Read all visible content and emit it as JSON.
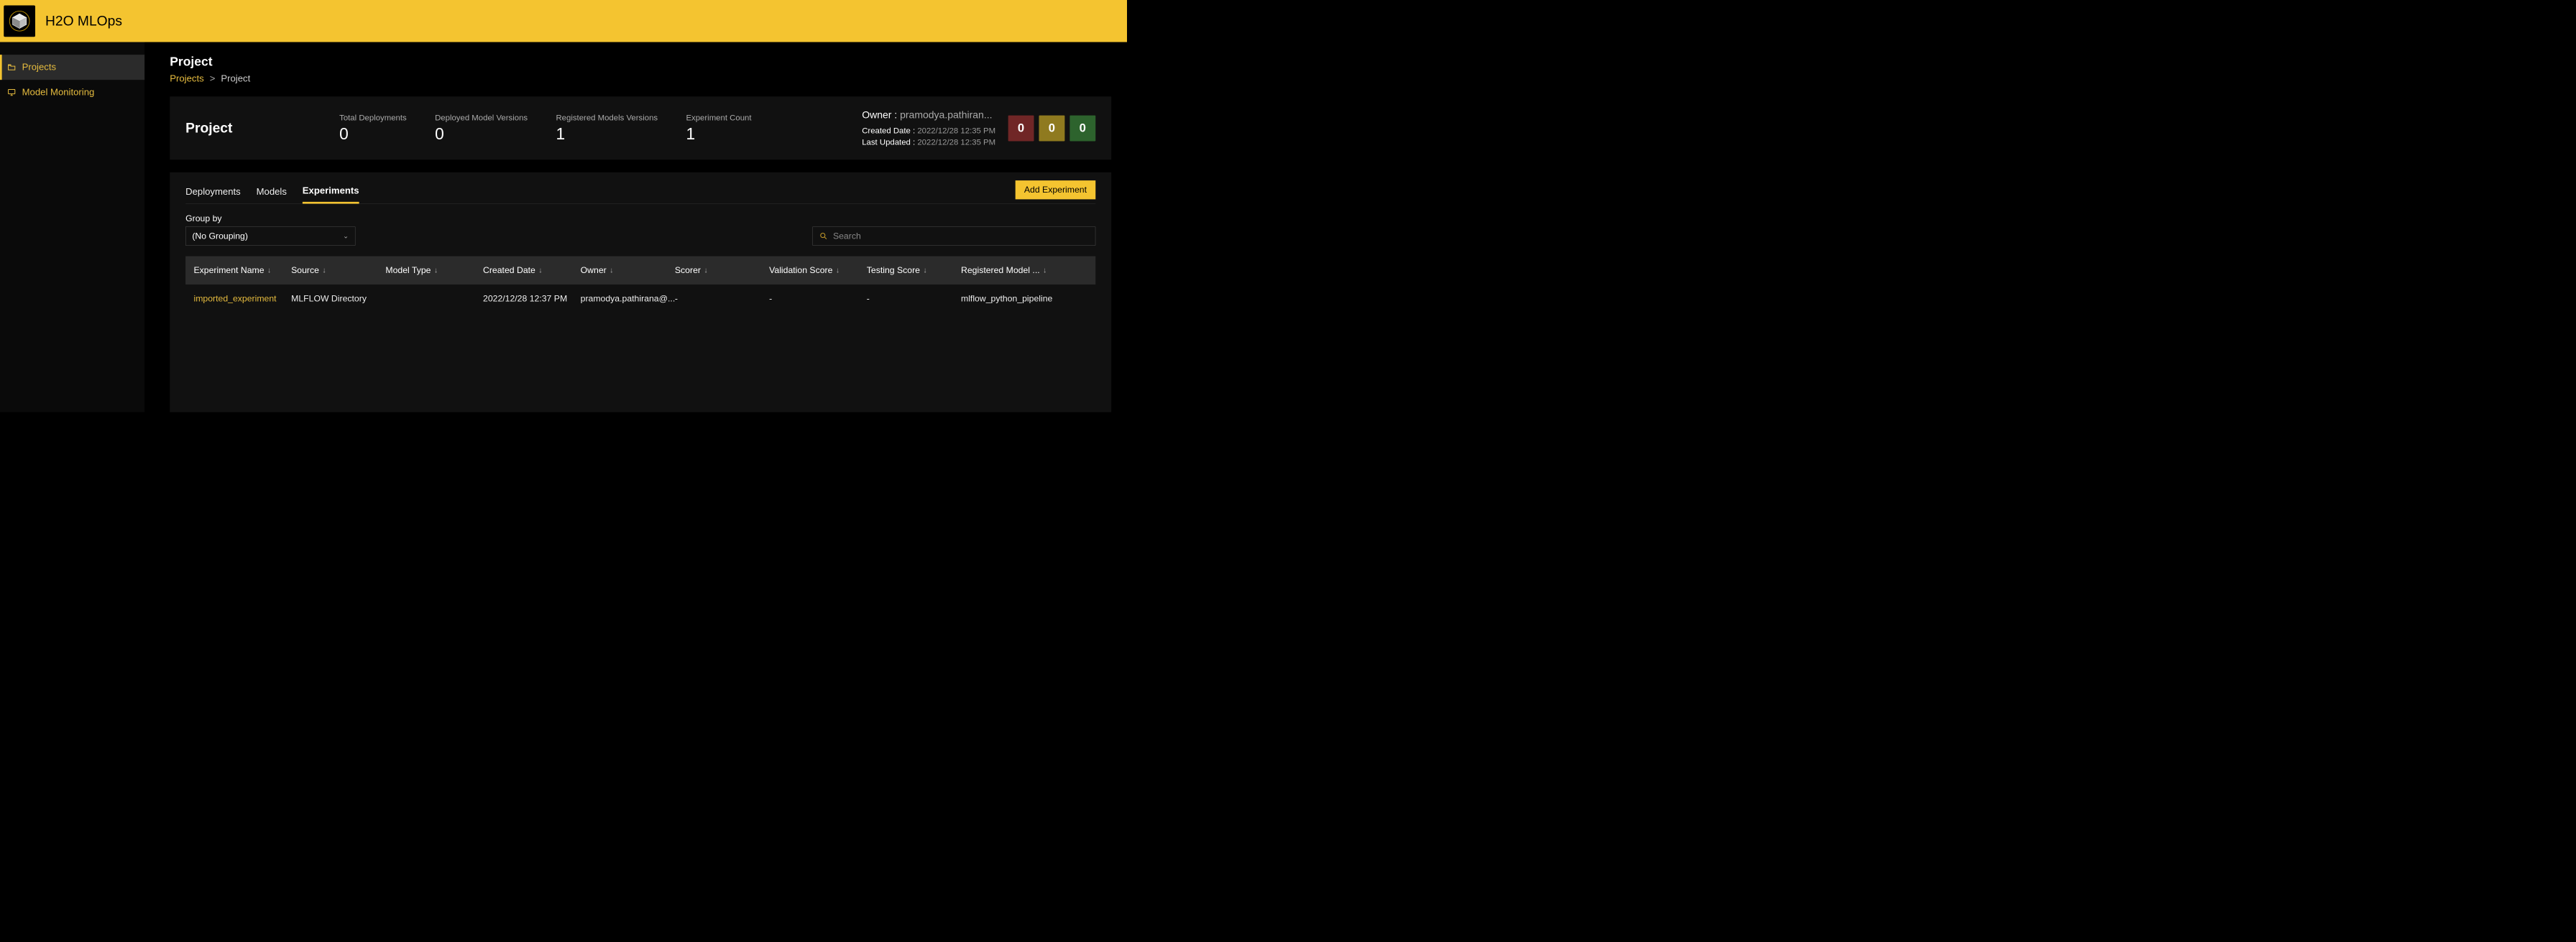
{
  "app": {
    "title": "H2O MLOps"
  },
  "sidebar": {
    "items": [
      {
        "label": "Projects"
      },
      {
        "label": "Model Monitoring"
      }
    ]
  },
  "page": {
    "title": "Project",
    "breadcrumb": {
      "root": "Projects",
      "current": "Project"
    }
  },
  "summary": {
    "title": "Project",
    "stats": [
      {
        "label": "Total Deployments",
        "value": "0"
      },
      {
        "label": "Deployed Model Versions",
        "value": "0"
      },
      {
        "label": "Registered Models Versions",
        "value": "1"
      },
      {
        "label": "Experiment Count",
        "value": "1"
      }
    ],
    "owner_label": "Owner :",
    "owner": "pramodya.pathiran...",
    "created_date_label": "Created Date :",
    "created_date": "2022/12/28 12:35 PM",
    "last_updated_label": "Last Updated :",
    "last_updated": "2022/12/28 12:35 PM",
    "tiles": [
      "0",
      "0",
      "0"
    ]
  },
  "tabs": {
    "items": [
      "Deployments",
      "Models",
      "Experiments"
    ],
    "active": 2,
    "add_button": "Add Experiment"
  },
  "filters": {
    "groupby_label": "Group by",
    "groupby_value": "(No Grouping)",
    "search_placeholder": "Search"
  },
  "table": {
    "columns": [
      "Experiment Name",
      "Source",
      "Model Type",
      "Created Date",
      "Owner",
      "Scorer",
      "Validation Score",
      "Testing Score",
      "Registered Model ..."
    ],
    "rows": [
      {
        "name": "imported_experiment",
        "source": "MLFLOW Directory",
        "model_type": "",
        "created": "2022/12/28 12:37 PM",
        "owner": "pramodya.pathirana@...",
        "scorer": "-",
        "validation": "-",
        "testing": "-",
        "registered": "mlflow_python_pipeline"
      }
    ]
  }
}
